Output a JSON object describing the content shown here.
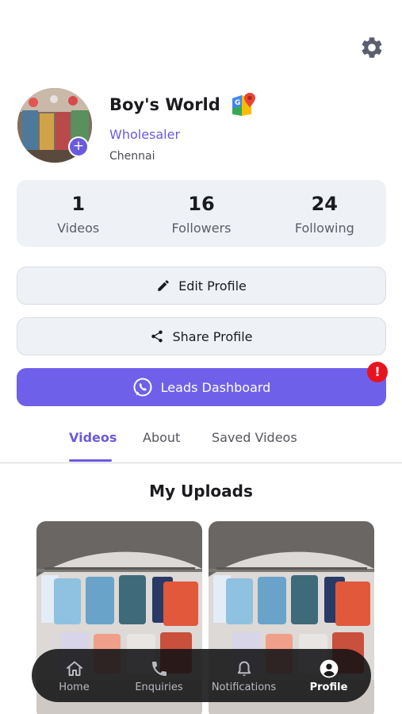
{
  "profile": {
    "name": "Boy's World",
    "role": "Wholesaler",
    "city": "Chennai"
  },
  "stats": [
    {
      "value": "1",
      "label": "Videos"
    },
    {
      "value": "16",
      "label": "Followers"
    },
    {
      "value": "24",
      "label": "Following"
    }
  ],
  "actions": {
    "edit_label": "Edit Profile",
    "share_label": "Share Profile",
    "leads_label": "Leads Dashboard",
    "leads_alert": "!"
  },
  "tabs": [
    {
      "label": "Videos",
      "active": true
    },
    {
      "label": "About",
      "active": false
    },
    {
      "label": "Saved Videos",
      "active": false
    }
  ],
  "uploads": {
    "title": "My Uploads"
  },
  "nav": [
    {
      "label": "Home",
      "icon": "home-icon",
      "active": false
    },
    {
      "label": "Enquiries",
      "icon": "phone-icon",
      "active": false
    },
    {
      "label": "Notifications",
      "icon": "bell-icon",
      "active": false
    },
    {
      "label": "Profile",
      "icon": "user-icon",
      "active": true
    }
  ],
  "colors": {
    "accent": "#6a5ae0",
    "leads_button": "#6f60ea",
    "alert": "#e8141d",
    "card_bg": "#eef1f6"
  }
}
